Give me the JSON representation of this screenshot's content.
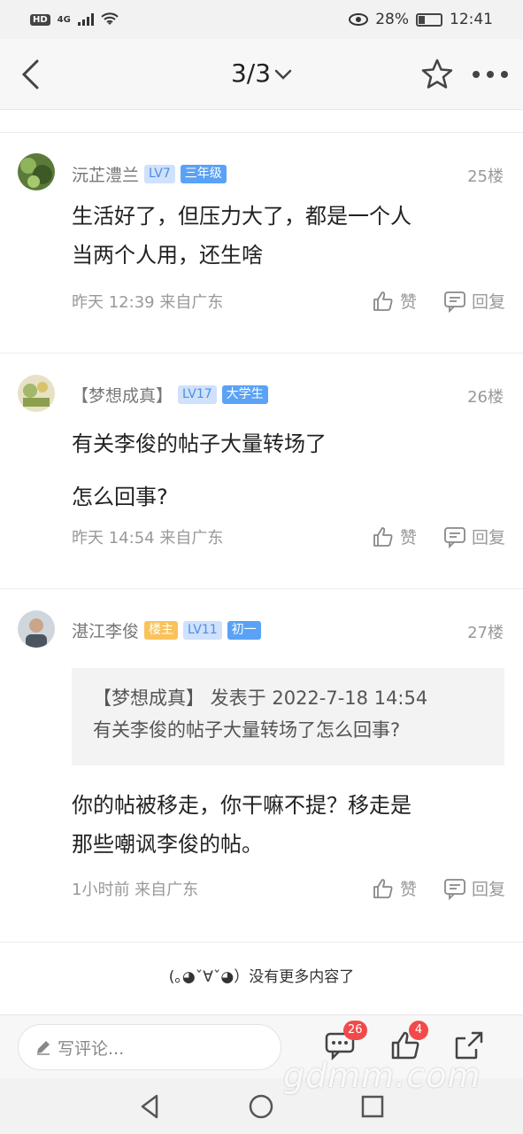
{
  "status_bar": {
    "hd": "HD",
    "network": "4G",
    "battery_text": "28%",
    "battery_level": 0.28,
    "time": "12:41"
  },
  "nav": {
    "title": "3/3",
    "back_icon": "chevron-left-icon",
    "star_icon": "star-icon",
    "more_icon": "more-icon"
  },
  "posts": [
    {
      "username": "沅芷澧兰",
      "tags": [
        "LV7",
        "三年级"
      ],
      "floor": "25楼",
      "lines": [
        "生活好了，但压力大了，都是一个人",
        "当两个人用，还生啥"
      ],
      "time": "昨天 12:39 来自广东",
      "like": "赞",
      "reply": "回复"
    },
    {
      "username": "【梦想成真】",
      "tags": [
        "LV17",
        "大学生"
      ],
      "floor": "26楼",
      "lines": [
        "有关李俊的帖子大量转场了",
        "怎么回事?"
      ],
      "time": "昨天 14:54 来自广东",
      "like": "赞",
      "reply": "回复"
    },
    {
      "username": "湛江李俊",
      "tags": [
        "楼主",
        "LV11",
        "初一"
      ],
      "floor": "27楼",
      "quote_line1": "【梦想成真】 发表于 2022-7-18 14:54",
      "quote_line2": "有关李俊的帖子大量转场了怎么回事?",
      "lines": [
        "你的帖被移走，你干嘛不提？移走是",
        "那些嘲讽李俊的帖。"
      ],
      "time": "1小时前 来自广东",
      "like": "赞",
      "reply": "回复"
    }
  ],
  "no_more": "(｡◕ˇ∀ˇ◕）没有更多内容了",
  "bottom_bar": {
    "comment_placeholder": "写评论...",
    "comment_count": "26",
    "like_count": "4"
  },
  "watermark": "gdmm.com",
  "colors": {
    "accent_blue": "#4a8ee8",
    "badge_red": "#f24a4a",
    "host_tag": "#f9c35b"
  }
}
